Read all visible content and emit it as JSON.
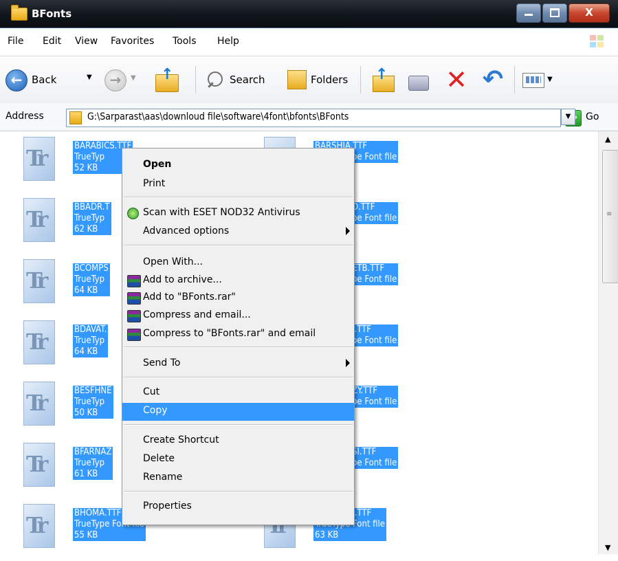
{
  "window": {
    "title": "BFonts",
    "buttons": {
      "minimize": "▁",
      "maximize": "□",
      "close": "X"
    }
  },
  "menubar": [
    "File",
    "Edit",
    "View",
    "Favorites",
    "Tools",
    "Help"
  ],
  "toolbar": {
    "back_label": "Back",
    "search_label": "Search",
    "folders_label": "Folders"
  },
  "address": {
    "label": "Address",
    "path": "G:\\Sarparast\\aas\\downloud file\\software\\4font\\bfonts\\BFonts",
    "go_label": "Go"
  },
  "files": [
    {
      "name": "BARABICS.TTF",
      "type": "TrueType Font file",
      "size": "52 KB"
    },
    {
      "name": "BARSHIA.TTF",
      "type": "TrueType Font file",
      "size": ""
    },
    {
      "name": "BBADR.TTF",
      "type": "TrueType Font file",
      "size": "62 KB"
    },
    {
      "name": "BBOLD.TTF",
      "type": "TrueType Font file",
      "size": ""
    },
    {
      "name": "BCOMPSET.TTF",
      "type": "TrueType Font file",
      "size": "64 KB"
    },
    {
      "name": "BCOMPSETB.TTF",
      "type": "TrueType Font file",
      "size": ""
    },
    {
      "name": "BDAVAT.TTF",
      "type": "TrueType Font file",
      "size": "64 KB"
    },
    {
      "name": "BDAVAT_I.TTF",
      "type": "TrueType Font file",
      "size": ""
    },
    {
      "name": "BESFHNE.TTF",
      "type": "TrueType Font file",
      "size": "50 KB"
    },
    {
      "name": "BFANTEZY.TTF",
      "type": "TrueType Font file",
      "size": ""
    },
    {
      "name": "BFARNAZ.TTF",
      "type": "TrueType Font file",
      "size": "61 KB"
    },
    {
      "name": "BFERDOSI.TTF",
      "type": "TrueType Font file",
      "size": ""
    },
    {
      "name": "BHOMA.TTF",
      "type": "TrueType Font file",
      "size": "55 KB"
    },
    {
      "name": "BJADIDBD.TTF",
      "type": "TrueType Font file",
      "size": "63 KB"
    }
  ],
  "file_visible": {
    "r0l": [
      "BARABICS.TTF",
      "TrueTyp",
      "52 KB"
    ],
    "r0r": [
      "BARSHIA.TTF",
      "pe Font file",
      ""
    ],
    "r1l": [
      "BBADR.T",
      "TrueTyp",
      "62 KB"
    ],
    "r1r": [
      "D.TTF",
      "pe Font file",
      ""
    ],
    "r2l": [
      "BCOMPS",
      "TrueTyp",
      "64 KB"
    ],
    "r2r": [
      "ETB.TTF",
      "pe Font file",
      ""
    ],
    "r3l": [
      "BDAVAT.",
      "TrueTyp",
      "64 KB"
    ],
    "r3r": [
      "I.TTF",
      "pe Font file",
      ""
    ],
    "r4l": [
      "BESFHNE",
      "TrueTyp",
      "50 KB"
    ],
    "r4r": [
      "ZY.TTF",
      "pe Font file",
      ""
    ],
    "r5l": [
      "BFARNAZ",
      "TrueTyp",
      "61 KB"
    ],
    "r5r": [
      "SI.TTF",
      "pe Font file",
      ""
    ],
    "r6l": [
      "BHOMA.TTF",
      "TrueType Font file",
      "55 KB"
    ],
    "r6r": [
      "BJADIDBD.TTF",
      "TrueType Font file",
      "63 KB"
    ]
  },
  "context_menu": {
    "open": "Open",
    "print": "Print",
    "scan": "Scan with ESET NOD32 Antivirus",
    "advanced": "Advanced options",
    "open_with": "Open With...",
    "add_archive": "Add to archive...",
    "add_rar": "Add to \"BFonts.rar\"",
    "compress_email": "Compress and email...",
    "compress_rar_email": "Compress to \"BFonts.rar\" and email",
    "send_to": "Send To",
    "cut": "Cut",
    "copy": "Copy",
    "create_shortcut": "Create Shortcut",
    "delete": "Delete",
    "rename": "Rename",
    "properties": "Properties"
  },
  "colors": {
    "selection": "#3399ff",
    "titlebar": "#10151b"
  }
}
